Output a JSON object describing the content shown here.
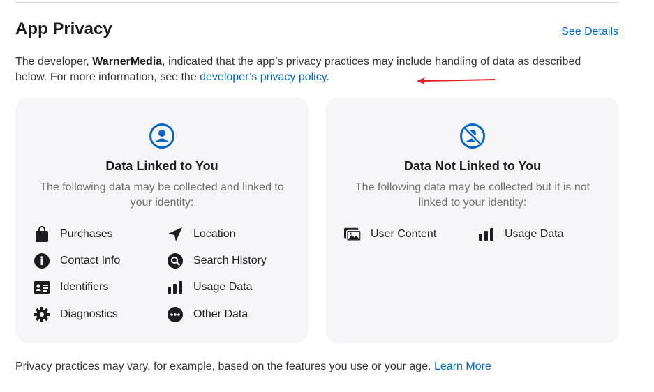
{
  "header": {
    "title": "App Privacy",
    "see_details": "See Details"
  },
  "description": {
    "prefix": "The developer, ",
    "developer": "WarnerMedia",
    "middle": ", indicated that the app’s privacy practices may include handling of data as described below. For more information, see the ",
    "link": "developer’s privacy policy",
    "suffix": "."
  },
  "linked": {
    "title": "Data Linked to You",
    "subtitle": "The following data may be collected and linked to your identity:",
    "items": [
      {
        "label": "Purchases",
        "icon": "bag-icon"
      },
      {
        "label": "Location",
        "icon": "location-arrow-icon"
      },
      {
        "label": "Contact Info",
        "icon": "info-icon"
      },
      {
        "label": "Search History",
        "icon": "search-icon"
      },
      {
        "label": "Identifiers",
        "icon": "id-card-icon"
      },
      {
        "label": "Usage Data",
        "icon": "bar-chart-icon"
      },
      {
        "label": "Diagnostics",
        "icon": "gear-icon"
      },
      {
        "label": "Other Data",
        "icon": "ellipsis-icon"
      }
    ]
  },
  "not_linked": {
    "title": "Data Not Linked to You",
    "subtitle": "The following data may be collected but it is not linked to your identity:",
    "items": [
      {
        "label": "User Content",
        "icon": "photo-icon"
      },
      {
        "label": "Usage Data",
        "icon": "bar-chart-icon"
      }
    ]
  },
  "footer": {
    "text": "Privacy practices may vary, for example, based on the features you use or your age. ",
    "link": "Learn More"
  },
  "colors": {
    "accent": "#0066cc",
    "card_bg": "#f5f5f7",
    "annotation_arrow": "#e02020"
  }
}
